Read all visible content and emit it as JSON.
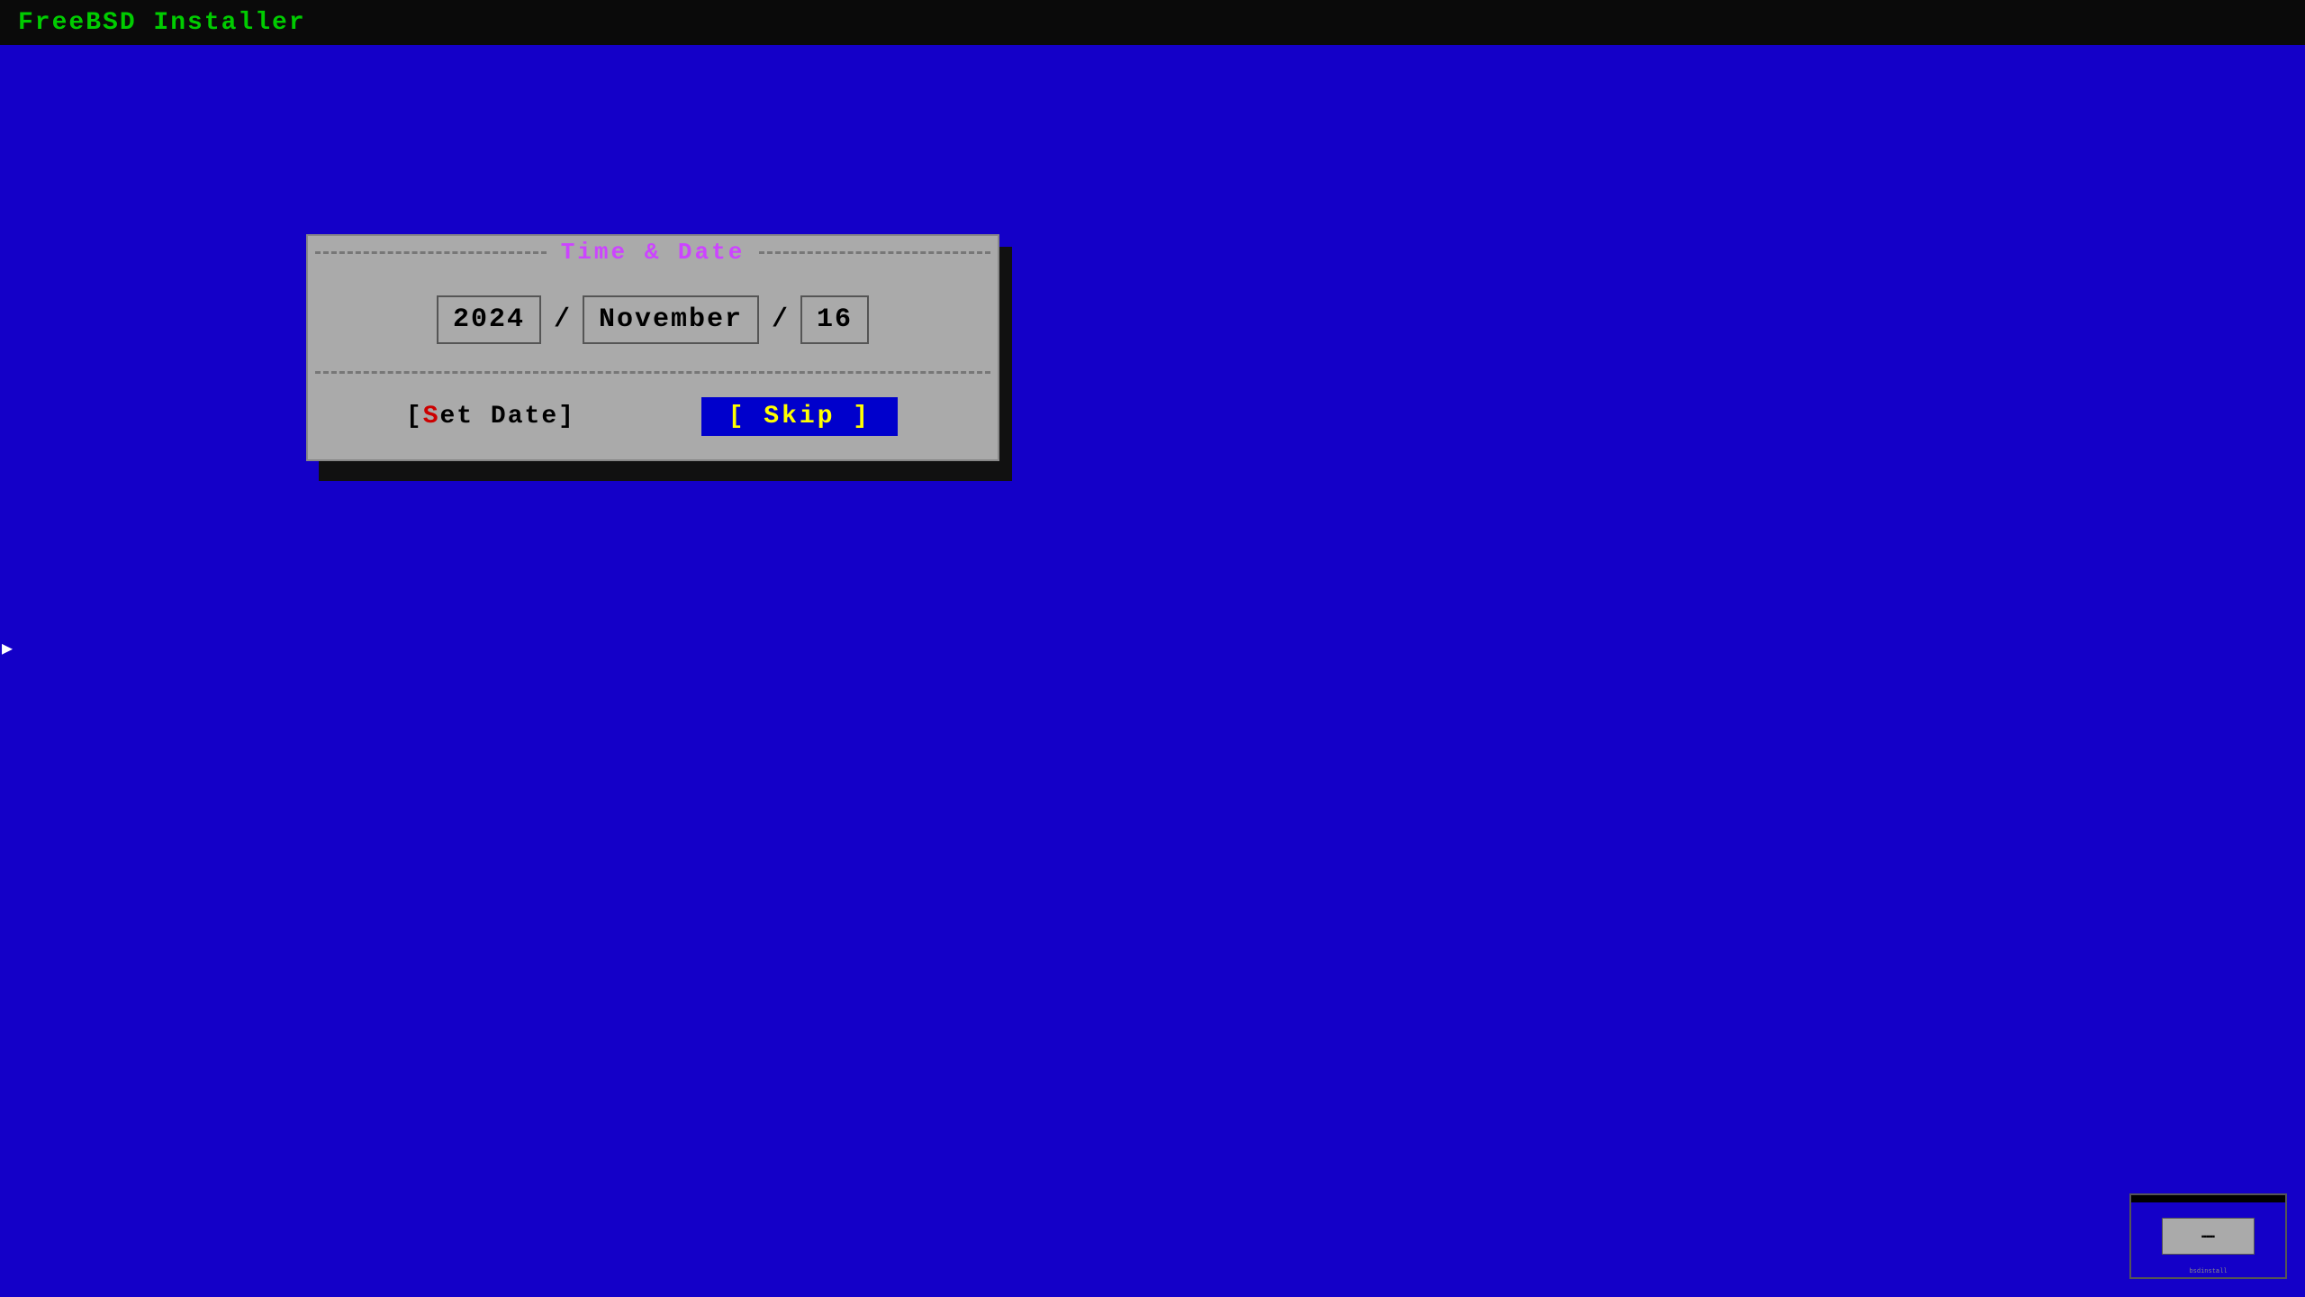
{
  "header": {
    "title": "FreeBSD Installer",
    "bg_color": "#0a0a0a",
    "text_color": "#00cc00"
  },
  "separator": {
    "color": "#00cccc",
    "pattern": "- - - - - - - - - - - - - - - - - - - - - - - - - - - - - - - - - - - - - - - - - - - - - - - - - - - - - - - - - - - - - - - - - - - - - - - - - - - - - - - - - - - - - - - - - - - - - - - - - - - - - - - - - - - - - - - - - - - - - - - - - - - - - - - - - - - - - - - - - - - - - - - - - -"
  },
  "scroll_indicator": {
    "symbol": "▶",
    "color": "#ffffff"
  },
  "dialog": {
    "title": "Time & Date",
    "title_color": "#cc44ff",
    "background": "#aaaaaa",
    "date": {
      "year": "2024",
      "month": "November",
      "day": "16",
      "separator": "/"
    },
    "buttons": {
      "set_date": {
        "label": "Set Date",
        "prefix": "[",
        "suffix": "]",
        "highlight_char": "S",
        "highlight_color": "#cc0000"
      },
      "skip": {
        "label": "Skip",
        "prefix": "[",
        "suffix": "]",
        "bg_color": "#0000cc",
        "text_color": "#ffff00"
      }
    }
  },
  "thumbnail": {
    "label": "bsdinstall"
  }
}
